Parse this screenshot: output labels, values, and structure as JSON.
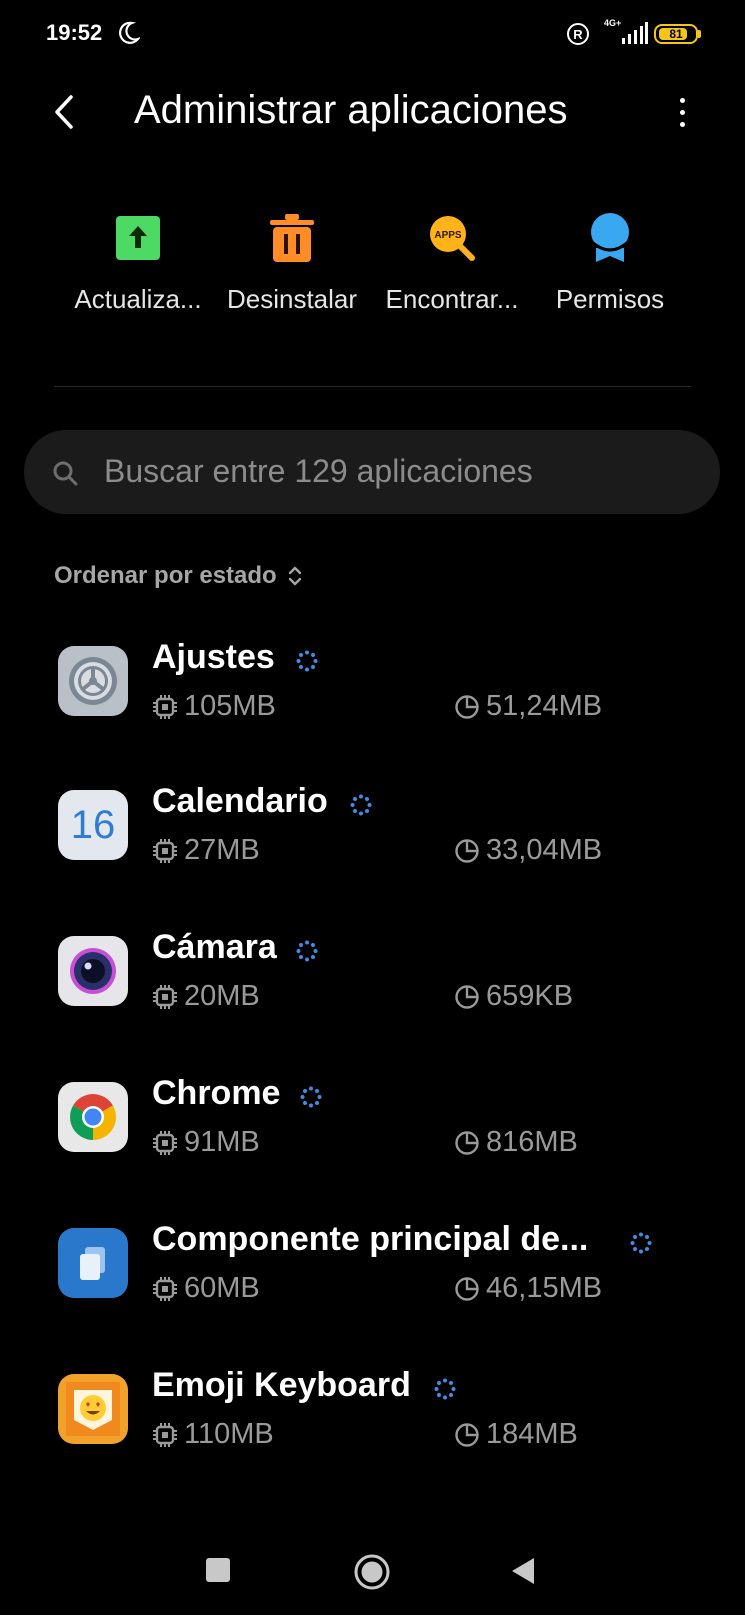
{
  "status_bar": {
    "time": "19:52",
    "network": "4G+",
    "battery_percent": "81",
    "battery_level": 0.81
  },
  "header": {
    "title": "Administrar aplicaciones"
  },
  "quick_actions": [
    {
      "label": "Actualiza...",
      "icon": "update-icon",
      "color": "#4cd964"
    },
    {
      "label": "Desinstalar",
      "icon": "trash-icon",
      "color": "#ff8c26"
    },
    {
      "label": "Encontrar...",
      "icon": "find-apps-icon",
      "color": "#ffb31a"
    },
    {
      "label": "Permisos",
      "icon": "permissions-icon",
      "color": "#3aa8f0"
    }
  ],
  "find_icon_text": "APPS",
  "search": {
    "placeholder": "Buscar entre 129 aplicaciones"
  },
  "sort": {
    "label": "Ordenar por estado"
  },
  "apps": [
    {
      "name": "Ajustes",
      "ram": "105MB",
      "storage": "51,24MB",
      "icon": "settings-icon"
    },
    {
      "name": "Calendario",
      "ram": "27MB",
      "storage": "33,04MB",
      "icon": "calendar-icon",
      "icon_text": "16"
    },
    {
      "name": "Cámara",
      "ram": "20MB",
      "storage": "659KB",
      "icon": "camera-icon"
    },
    {
      "name": "Chrome",
      "ram": "91MB",
      "storage": "816MB",
      "icon": "chrome-icon"
    },
    {
      "name": "Componente principal de...",
      "ram": "60MB",
      "storage": "46,15MB",
      "icon": "component-icon"
    },
    {
      "name": "Emoji Keyboard",
      "ram": "110MB",
      "storage": "184MB",
      "icon": "emoji-keyboard-icon"
    }
  ],
  "colors": {
    "background": "#000000",
    "accent": "#3a8ee6",
    "secondary_text": "#9a9a9a"
  }
}
